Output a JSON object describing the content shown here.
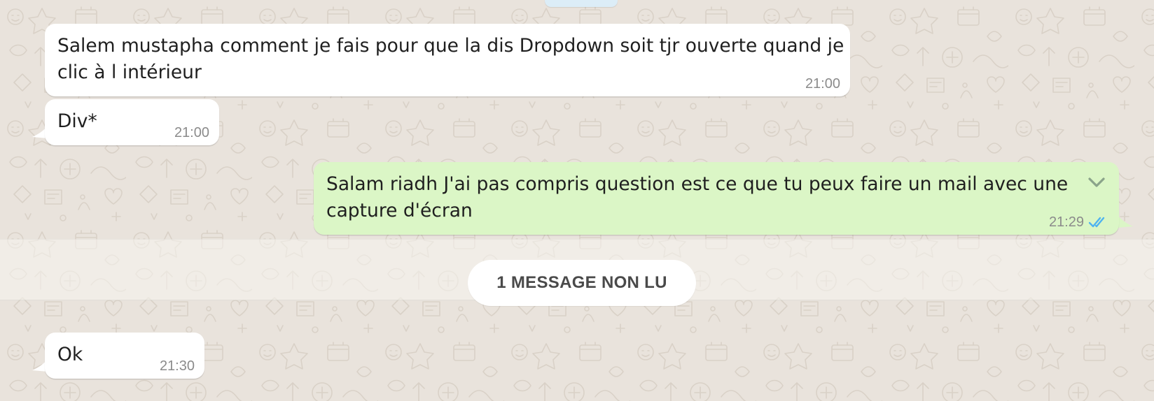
{
  "messages": [
    {
      "direction": "in",
      "lines": [
        "Salem mustapha comment je fais pour que la dis Dropdown soit tjr ouverte quand je",
        "clic à l intérieur"
      ],
      "time": "21:00"
    },
    {
      "direction": "in",
      "lines": [
        "Div*"
      ],
      "time": "21:00"
    },
    {
      "direction": "out",
      "lines": [
        "Salam riadh J'ai pas compris question est ce que tu peux faire un mail avec une",
        "capture d'écran"
      ],
      "time": "21:29",
      "status_icon": "double-check-icon",
      "menu_icon": "chevron-down-icon"
    },
    {
      "direction": "in",
      "lines": [
        "Ok"
      ],
      "time": "21:30"
    }
  ],
  "unread_divider": {
    "label": "1 MESSAGE NON LU"
  },
  "colors": {
    "wallpaper": "#e9e3dc",
    "incoming_bubble": "#ffffff",
    "outgoing_bubble": "#dbf6c6",
    "read_ticks": "#4fb3f0",
    "timestamp": "#8b8b8b"
  }
}
